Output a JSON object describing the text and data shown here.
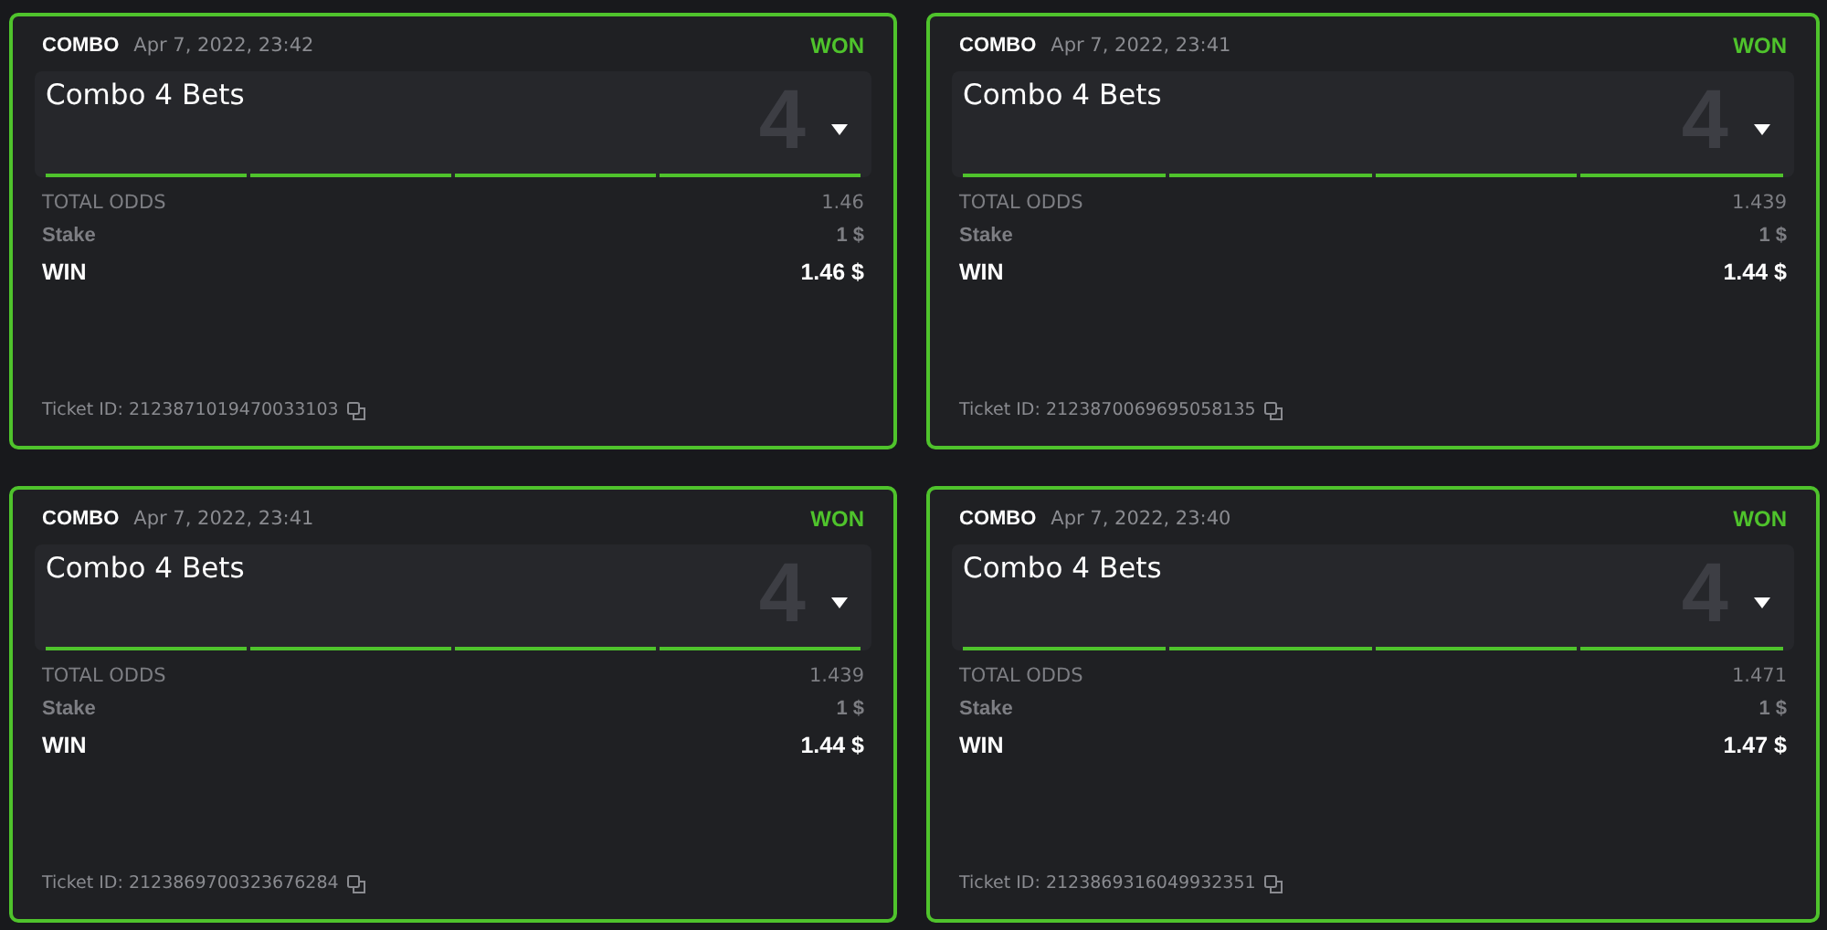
{
  "tickets": [
    {
      "type": "COMBO",
      "date": "Apr 7, 2022, 23:42",
      "status": "WON",
      "title": "Combo 4 Bets",
      "count": "4",
      "legs": [
        {
          "won": true
        },
        {
          "won": true
        },
        {
          "won": true
        },
        {
          "won": true
        }
      ],
      "odds_label": "TOTAL ODDS",
      "odds": "1.46",
      "stake_label": "Stake",
      "stake": "1 $",
      "win_label": "WIN",
      "win": "1.46 $",
      "ticket_id": "Ticket ID: 2123871019470033103"
    },
    {
      "type": "COMBO",
      "date": "Apr 7, 2022, 23:41",
      "status": "WON",
      "title": "Combo 4 Bets",
      "count": "4",
      "legs": [
        {
          "won": true
        },
        {
          "won": true
        },
        {
          "won": true
        },
        {
          "won": true
        }
      ],
      "odds_label": "TOTAL ODDS",
      "odds": "1.439",
      "stake_label": "Stake",
      "stake": "1 $",
      "win_label": "WIN",
      "win": "1.44 $",
      "ticket_id": "Ticket ID: 2123870069695058135"
    },
    {
      "type": "COMBO",
      "date": "Apr 7, 2022, 23:41",
      "status": "WON",
      "title": "Combo 4 Bets",
      "count": "4",
      "legs": [
        {
          "won": true
        },
        {
          "won": true
        },
        {
          "won": true
        },
        {
          "won": true
        }
      ],
      "odds_label": "TOTAL ODDS",
      "odds": "1.439",
      "stake_label": "Stake",
      "stake": "1 $",
      "win_label": "WIN",
      "win": "1.44 $",
      "ticket_id": "Ticket ID: 2123869700323676284"
    },
    {
      "type": "COMBO",
      "date": "Apr 7, 2022, 23:40",
      "status": "WON",
      "title": "Combo 4 Bets",
      "count": "4",
      "legs": [
        {
          "won": true
        },
        {
          "won": true
        },
        {
          "won": true
        },
        {
          "won": true
        }
      ],
      "odds_label": "TOTAL ODDS",
      "odds": "1.471",
      "stake_label": "Stake",
      "stake": "1 $",
      "win_label": "WIN",
      "win": "1.47 $",
      "ticket_id": "Ticket ID: 2123869316049932351"
    }
  ]
}
